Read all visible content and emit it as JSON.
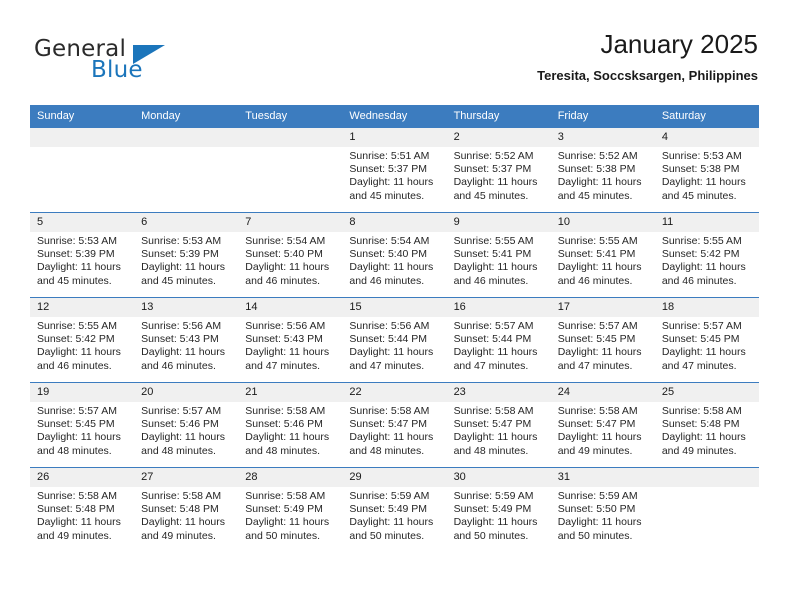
{
  "brand": {
    "name_part1": "General",
    "name_part2": "Blue",
    "accent_color": "#1b75bb"
  },
  "header": {
    "title": "January 2025",
    "subtitle": "Teresita, Soccsksargen, Philippines"
  },
  "calendar": {
    "header_bg": "#3c7cbf",
    "daynum_bg": "#f0f0f0",
    "weekdays": [
      "Sunday",
      "Monday",
      "Tuesday",
      "Wednesday",
      "Thursday",
      "Friday",
      "Saturday"
    ],
    "labels": {
      "sunrise": "Sunrise:",
      "sunset": "Sunset:",
      "daylight": "Daylight:"
    },
    "weeks": [
      [
        {
          "day": "",
          "empty": true
        },
        {
          "day": "",
          "empty": true
        },
        {
          "day": "",
          "empty": true
        },
        {
          "day": "1",
          "sunrise": "Sunrise: 5:51 AM",
          "sunset": "Sunset: 5:37 PM",
          "daylight1": "Daylight: 11 hours",
          "daylight2": "and 45 minutes."
        },
        {
          "day": "2",
          "sunrise": "Sunrise: 5:52 AM",
          "sunset": "Sunset: 5:37 PM",
          "daylight1": "Daylight: 11 hours",
          "daylight2": "and 45 minutes."
        },
        {
          "day": "3",
          "sunrise": "Sunrise: 5:52 AM",
          "sunset": "Sunset: 5:38 PM",
          "daylight1": "Daylight: 11 hours",
          "daylight2": "and 45 minutes."
        },
        {
          "day": "4",
          "sunrise": "Sunrise: 5:53 AM",
          "sunset": "Sunset: 5:38 PM",
          "daylight1": "Daylight: 11 hours",
          "daylight2": "and 45 minutes."
        }
      ],
      [
        {
          "day": "5",
          "sunrise": "Sunrise: 5:53 AM",
          "sunset": "Sunset: 5:39 PM",
          "daylight1": "Daylight: 11 hours",
          "daylight2": "and 45 minutes."
        },
        {
          "day": "6",
          "sunrise": "Sunrise: 5:53 AM",
          "sunset": "Sunset: 5:39 PM",
          "daylight1": "Daylight: 11 hours",
          "daylight2": "and 45 minutes."
        },
        {
          "day": "7",
          "sunrise": "Sunrise: 5:54 AM",
          "sunset": "Sunset: 5:40 PM",
          "daylight1": "Daylight: 11 hours",
          "daylight2": "and 46 minutes."
        },
        {
          "day": "8",
          "sunrise": "Sunrise: 5:54 AM",
          "sunset": "Sunset: 5:40 PM",
          "daylight1": "Daylight: 11 hours",
          "daylight2": "and 46 minutes."
        },
        {
          "day": "9",
          "sunrise": "Sunrise: 5:55 AM",
          "sunset": "Sunset: 5:41 PM",
          "daylight1": "Daylight: 11 hours",
          "daylight2": "and 46 minutes."
        },
        {
          "day": "10",
          "sunrise": "Sunrise: 5:55 AM",
          "sunset": "Sunset: 5:41 PM",
          "daylight1": "Daylight: 11 hours",
          "daylight2": "and 46 minutes."
        },
        {
          "day": "11",
          "sunrise": "Sunrise: 5:55 AM",
          "sunset": "Sunset: 5:42 PM",
          "daylight1": "Daylight: 11 hours",
          "daylight2": "and 46 minutes."
        }
      ],
      [
        {
          "day": "12",
          "sunrise": "Sunrise: 5:55 AM",
          "sunset": "Sunset: 5:42 PM",
          "daylight1": "Daylight: 11 hours",
          "daylight2": "and 46 minutes."
        },
        {
          "day": "13",
          "sunrise": "Sunrise: 5:56 AM",
          "sunset": "Sunset: 5:43 PM",
          "daylight1": "Daylight: 11 hours",
          "daylight2": "and 46 minutes."
        },
        {
          "day": "14",
          "sunrise": "Sunrise: 5:56 AM",
          "sunset": "Sunset: 5:43 PM",
          "daylight1": "Daylight: 11 hours",
          "daylight2": "and 47 minutes."
        },
        {
          "day": "15",
          "sunrise": "Sunrise: 5:56 AM",
          "sunset": "Sunset: 5:44 PM",
          "daylight1": "Daylight: 11 hours",
          "daylight2": "and 47 minutes."
        },
        {
          "day": "16",
          "sunrise": "Sunrise: 5:57 AM",
          "sunset": "Sunset: 5:44 PM",
          "daylight1": "Daylight: 11 hours",
          "daylight2": "and 47 minutes."
        },
        {
          "day": "17",
          "sunrise": "Sunrise: 5:57 AM",
          "sunset": "Sunset: 5:45 PM",
          "daylight1": "Daylight: 11 hours",
          "daylight2": "and 47 minutes."
        },
        {
          "day": "18",
          "sunrise": "Sunrise: 5:57 AM",
          "sunset": "Sunset: 5:45 PM",
          "daylight1": "Daylight: 11 hours",
          "daylight2": "and 47 minutes."
        }
      ],
      [
        {
          "day": "19",
          "sunrise": "Sunrise: 5:57 AM",
          "sunset": "Sunset: 5:45 PM",
          "daylight1": "Daylight: 11 hours",
          "daylight2": "and 48 minutes."
        },
        {
          "day": "20",
          "sunrise": "Sunrise: 5:57 AM",
          "sunset": "Sunset: 5:46 PM",
          "daylight1": "Daylight: 11 hours",
          "daylight2": "and 48 minutes."
        },
        {
          "day": "21",
          "sunrise": "Sunrise: 5:58 AM",
          "sunset": "Sunset: 5:46 PM",
          "daylight1": "Daylight: 11 hours",
          "daylight2": "and 48 minutes."
        },
        {
          "day": "22",
          "sunrise": "Sunrise: 5:58 AM",
          "sunset": "Sunset: 5:47 PM",
          "daylight1": "Daylight: 11 hours",
          "daylight2": "and 48 minutes."
        },
        {
          "day": "23",
          "sunrise": "Sunrise: 5:58 AM",
          "sunset": "Sunset: 5:47 PM",
          "daylight1": "Daylight: 11 hours",
          "daylight2": "and 48 minutes."
        },
        {
          "day": "24",
          "sunrise": "Sunrise: 5:58 AM",
          "sunset": "Sunset: 5:47 PM",
          "daylight1": "Daylight: 11 hours",
          "daylight2": "and 49 minutes."
        },
        {
          "day": "25",
          "sunrise": "Sunrise: 5:58 AM",
          "sunset": "Sunset: 5:48 PM",
          "daylight1": "Daylight: 11 hours",
          "daylight2": "and 49 minutes."
        }
      ],
      [
        {
          "day": "26",
          "sunrise": "Sunrise: 5:58 AM",
          "sunset": "Sunset: 5:48 PM",
          "daylight1": "Daylight: 11 hours",
          "daylight2": "and 49 minutes."
        },
        {
          "day": "27",
          "sunrise": "Sunrise: 5:58 AM",
          "sunset": "Sunset: 5:48 PM",
          "daylight1": "Daylight: 11 hours",
          "daylight2": "and 49 minutes."
        },
        {
          "day": "28",
          "sunrise": "Sunrise: 5:58 AM",
          "sunset": "Sunset: 5:49 PM",
          "daylight1": "Daylight: 11 hours",
          "daylight2": "and 50 minutes."
        },
        {
          "day": "29",
          "sunrise": "Sunrise: 5:59 AM",
          "sunset": "Sunset: 5:49 PM",
          "daylight1": "Daylight: 11 hours",
          "daylight2": "and 50 minutes."
        },
        {
          "day": "30",
          "sunrise": "Sunrise: 5:59 AM",
          "sunset": "Sunset: 5:49 PM",
          "daylight1": "Daylight: 11 hours",
          "daylight2": "and 50 minutes."
        },
        {
          "day": "31",
          "sunrise": "Sunrise: 5:59 AM",
          "sunset": "Sunset: 5:50 PM",
          "daylight1": "Daylight: 11 hours",
          "daylight2": "and 50 minutes."
        },
        {
          "day": "",
          "empty": true
        }
      ]
    ]
  }
}
